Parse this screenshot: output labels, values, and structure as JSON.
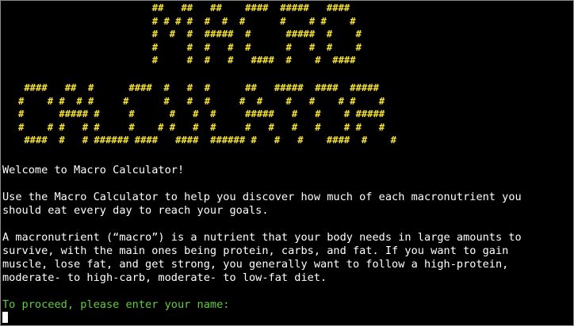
{
  "terminal": {
    "banner_macro": "                          ##   ##   ##    ####  #####   ####\n                          # # # #  #  #  #      #    # #    #\n                          #  #  #  #####  #      #####  #    #\n                          #     #  #   #  #      #   #  #    #\n                          #     #  #   #   ####  #    #  ####",
    "banner_calculator": "    ####   ##  #      ####  #   #  #      ##   #####  ####  #####\n   #    # #  # #     #      #   #  #     #  #    #   #    # #    #\n   #      ##### #     #      #   #  #     #####   #   #    # #####\n   #    # #   # #     #    # #   #  #     #   #   #   #    # #   #\n    ####  #   # ###### ####   ####  ###### #   #   #    ####  #    #",
    "banner_color": "#f5e131",
    "welcome_line": "Welcome to Macro Calculator!",
    "intro_paragraph": "Use the Macro Calculator to help you discover how much of each macronutrient you\nshould eat every day to reach your goals.",
    "macro_paragraph": "A macronutrient (“macro”) is a nutrient that your body needs in large amounts to\nsurvive, with the main ones being protein, carbs, and fat. If you want to gain\nmuscle, lose fat, and get strong, you generally want to follow a high-protein,\nmoderate- to high-carb, moderate- to low-fat diet.",
    "input_prompt": "To proceed, please enter your name:",
    "prompt_color": "#5fcf3a",
    "input_value": ""
  }
}
